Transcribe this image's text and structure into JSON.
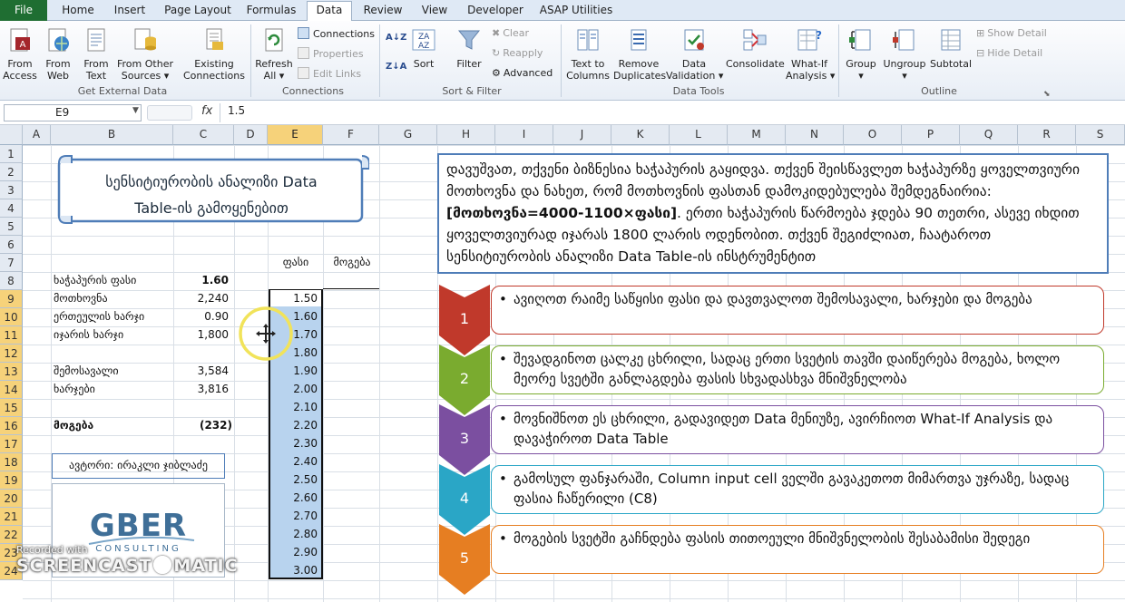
{
  "tabs": [
    "File",
    "Home",
    "Insert",
    "Page Layout",
    "Formulas",
    "Data",
    "Review",
    "View",
    "Developer",
    "ASAP Utilities"
  ],
  "ribbon": {
    "get_external_data": {
      "from_access": "From\nAccess",
      "from_web": "From\nWeb",
      "from_text": "From\nText",
      "from_other": "From Other\nSources ▾",
      "existing": "Existing\nConnections",
      "label": "Get External Data"
    },
    "connections": {
      "refresh": "Refresh\nAll ▾",
      "connections": "Connections",
      "properties": "Properties",
      "edit_links": "Edit Links",
      "label": "Connections"
    },
    "sort_filter": {
      "sort": "Sort",
      "filter": "Filter",
      "clear": "Clear",
      "reapply": "Reapply",
      "advanced": "Advanced",
      "label": "Sort & Filter"
    },
    "data_tools": {
      "text_to_columns": "Text to\nColumns",
      "remove_duplicates": "Remove\nDuplicates",
      "data_validation": "Data\nValidation ▾",
      "consolidate": "Consolidate",
      "what_if": "What-If\nAnalysis ▾",
      "label": "Data Tools"
    },
    "outline": {
      "group": "Group\n▾",
      "ungroup": "Ungroup\n▾",
      "subtotal": "Subtotal",
      "show_detail": "Show Detail",
      "hide_detail": "Hide Detail",
      "label": "Outline"
    }
  },
  "formula_bar": {
    "name_box": "E9",
    "fx": "fx",
    "value": "1.5"
  },
  "columns": [
    "A",
    "B",
    "C",
    "D",
    "E",
    "F",
    "G",
    "H",
    "I",
    "J",
    "K",
    "L",
    "M",
    "N",
    "O",
    "P",
    "Q",
    "R",
    "S"
  ],
  "rows": [
    "1",
    "2",
    "3",
    "4",
    "5",
    "6",
    "7",
    "8",
    "9",
    "10",
    "11",
    "12",
    "13",
    "14",
    "15",
    "16",
    "17",
    "18",
    "19",
    "20",
    "21",
    "22",
    "23",
    "24"
  ],
  "title_scroll": {
    "line1": "სენსიტიურობის ანალიზი Data",
    "line2": "Table-ის გამოყენებით"
  },
  "inputs": [
    {
      "label": "ხაჭაპურის ფასი",
      "value": "1.60",
      "bold": true
    },
    {
      "label": "მოთხოვნა",
      "value": "2,240"
    },
    {
      "label": "ერთეულის ხარჯი",
      "value": "0.90"
    },
    {
      "label": "იჯარის ხარჯი",
      "value": "1,800"
    }
  ],
  "revenue": {
    "label": "შემოსავალი",
    "value": "3,584"
  },
  "costs": {
    "label": "ხარჯები",
    "value": "3,816"
  },
  "profit": {
    "label": "მოგება",
    "value": "(232)"
  },
  "table_headers": {
    "price": "ფასი",
    "profit": "მოგება"
  },
  "prices": [
    "1.50",
    "1.60",
    "1.70",
    "1.80",
    "1.90",
    "2.00",
    "2.10",
    "2.20",
    "2.30",
    "2.40",
    "2.50",
    "2.60",
    "2.70",
    "2.80",
    "2.90",
    "3.00"
  ],
  "author": "ავტორი: ირაკლი ჯიბლაძე",
  "logo": {
    "main": "GBER",
    "sub": "CONSULTING"
  },
  "task": {
    "p1": "დავუშვათ, თქვენი ბიზნესია ხაჭაპურის გაყიდვა. თქვენ შეისწავლეთ ხაჭაპურზე ყოველთვიური მოთხოვნა და ნახეთ, რომ მოთხოვნის ფასთან დამოკიდებულება შემდეგნაირია: ",
    "formula": "[მოთხოვნა=4000-1100×ფასი]",
    "p2": ". ერთი ხაჭაპურის წარმოება ჯდება 90 თეთრი, ასევე იხდით ყოველთვიურად იჯარას 1800 ლარის ოდენობით. თქვენ შეგიძლიათ, ჩაატაროთ სენსიტიურობის ანალიზი Data Table-ის ინსტრუმენტით"
  },
  "steps": [
    {
      "num": "1",
      "text": "ავიღოთ რაიმე საწყისი ფასი და დავთვალოთ შემოსავალი, ხარჯები და მოგება",
      "color": "#c0392b"
    },
    {
      "num": "2",
      "text": "შევადგინოთ ცალკე ცხრილი, სადაც ერთი სვეტის თავში დაიწერება მოგება, ხოლო მეორე სვეტში განლაგდება ფასის სხვადასხვა მნიშვნელობა",
      "color": "#7aab2f"
    },
    {
      "num": "3",
      "text": "მოვნიშნოთ ეს ცხრილი, გადავიდეთ Data მენიუზე, ავირჩიოთ What-If Analysis და დავაჭიროთ Data Table",
      "color": "#7b4fa0"
    },
    {
      "num": "4",
      "text": "გამოსულ ფანჯარაში,  Column input cell ველში გავაკეთოთ მიმართვა უჯრაზე, სადაც ფასია ჩაწერილი (C8)",
      "color": "#2aa6c6"
    },
    {
      "num": "5",
      "text": "მოგების სვეტში გაჩნდება ფასის თითოეული მნიშვნელობის შესაბამისი შედეგი",
      "color": "#e67e22"
    }
  ],
  "watermark": {
    "line1": "Recorded with",
    "line2": "SCREENCAST",
    "line3": "MATIC"
  }
}
